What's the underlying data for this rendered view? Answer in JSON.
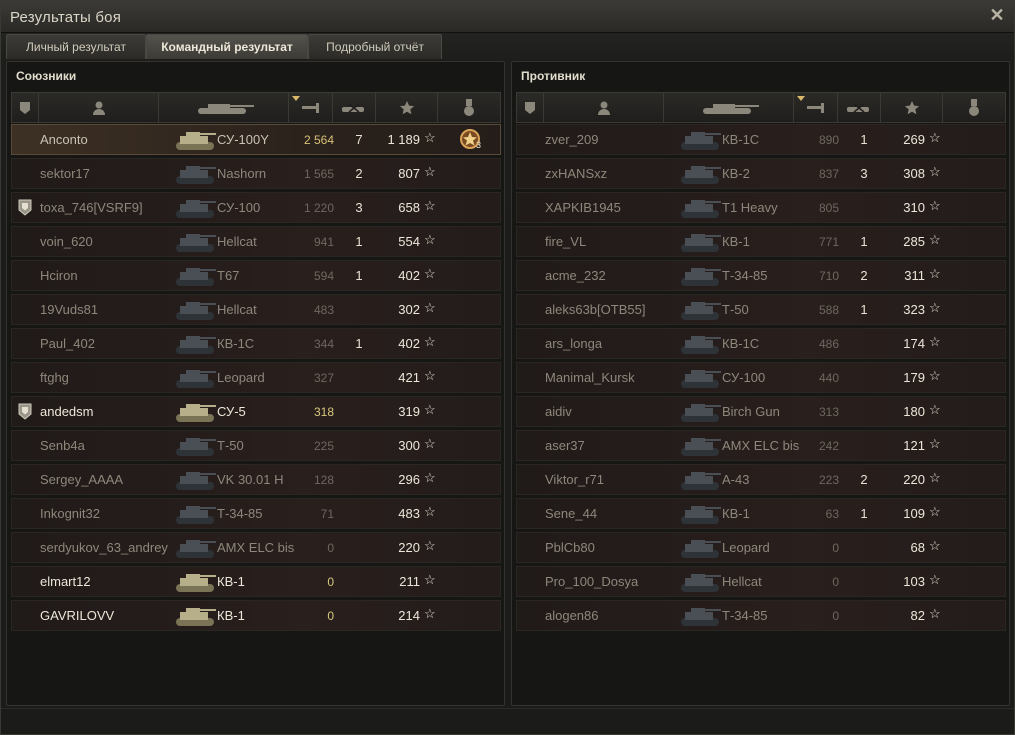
{
  "window": {
    "title": "Результаты боя"
  },
  "tabs": [
    {
      "label": "Личный результат"
    },
    {
      "label": "Командный результат"
    },
    {
      "label": "Подробный отчёт"
    }
  ],
  "allies": {
    "title": "Союзники",
    "rows": [
      {
        "name": "Anconto",
        "tank": "СУ-100Y",
        "damage": "2 564",
        "kills": "7",
        "xp": "1 189",
        "state": "highlight",
        "platoon": false,
        "medal": "3"
      },
      {
        "name": "sektor17",
        "tank": "Nashorn",
        "damage": "1 565",
        "kills": "2",
        "xp": "807",
        "state": "dead",
        "platoon": false
      },
      {
        "name": "toxa_746[VSRF9]",
        "tank": "СУ-100",
        "damage": "1 220",
        "kills": "3",
        "xp": "658",
        "state": "dead",
        "platoon": true
      },
      {
        "name": "voin_620",
        "tank": "Hellcat",
        "damage": "941",
        "kills": "1",
        "xp": "554",
        "state": "dead",
        "platoon": false
      },
      {
        "name": "Hciron",
        "tank": "T67",
        "damage": "594",
        "kills": "1",
        "xp": "402",
        "state": "dead",
        "platoon": false
      },
      {
        "name": "19Vuds81",
        "tank": "Hellcat",
        "damage": "483",
        "kills": "",
        "xp": "302",
        "state": "dead",
        "platoon": false
      },
      {
        "name": "Paul_402",
        "tank": "КВ-1С",
        "damage": "344",
        "kills": "1",
        "xp": "402",
        "state": "dead",
        "platoon": false
      },
      {
        "name": "ftghg",
        "tank": "Leopard",
        "damage": "327",
        "kills": "",
        "xp": "421",
        "state": "dead",
        "platoon": false
      },
      {
        "name": "andedsm",
        "tank": "СУ-5",
        "damage": "318",
        "kills": "",
        "xp": "319",
        "state": "alive",
        "platoon": true
      },
      {
        "name": "Senb4a",
        "tank": "Т-50",
        "damage": "225",
        "kills": "",
        "xp": "300",
        "state": "dead",
        "platoon": false
      },
      {
        "name": "Sergey_AAAA",
        "tank": "VK 30.01 H",
        "damage": "128",
        "kills": "",
        "xp": "296",
        "state": "dead",
        "platoon": false
      },
      {
        "name": "Inkognit32",
        "tank": "Т-34-85",
        "damage": "71",
        "kills": "",
        "xp": "483",
        "state": "dead",
        "platoon": false
      },
      {
        "name": "serdyukov_63_andrey",
        "tank": "AMX ELC bis",
        "damage": "0",
        "kills": "",
        "xp": "220",
        "state": "dead",
        "platoon": false
      },
      {
        "name": "elmart12",
        "tank": "КВ-1",
        "damage": "0",
        "kills": "",
        "xp": "211",
        "state": "alive",
        "platoon": false
      },
      {
        "name": "GAVRILOVV",
        "tank": "КВ-1",
        "damage": "0",
        "kills": "",
        "xp": "214",
        "state": "alive",
        "platoon": false
      }
    ]
  },
  "enemies": {
    "title": "Противник",
    "rows": [
      {
        "name": "zver_209",
        "tank": "КВ-1С",
        "damage": "890",
        "kills": "1",
        "xp": "269",
        "state": "dead",
        "platoon": false
      },
      {
        "name": "zxHANSxz",
        "tank": "КВ-2",
        "damage": "837",
        "kills": "3",
        "xp": "308",
        "state": "dead",
        "platoon": false
      },
      {
        "name": "XAPKIB1945",
        "tank": "T1 Heavy",
        "damage": "805",
        "kills": "",
        "xp": "310",
        "state": "dead",
        "platoon": false
      },
      {
        "name": "fire_VL",
        "tank": "КВ-1",
        "damage": "771",
        "kills": "1",
        "xp": "285",
        "state": "dead",
        "platoon": false
      },
      {
        "name": "acme_232",
        "tank": "Т-34-85",
        "damage": "710",
        "kills": "2",
        "xp": "311",
        "state": "dead",
        "platoon": false
      },
      {
        "name": "aleks63b[OTB55]",
        "tank": "Т-50",
        "damage": "588",
        "kills": "1",
        "xp": "323",
        "state": "dead",
        "platoon": false
      },
      {
        "name": "ars_longa",
        "tank": "КВ-1С",
        "damage": "486",
        "kills": "",
        "xp": "174",
        "state": "dead",
        "platoon": false
      },
      {
        "name": "Manimal_Kursk",
        "tank": "СУ-100",
        "damage": "440",
        "kills": "",
        "xp": "179",
        "state": "dead",
        "platoon": false
      },
      {
        "name": "aidiv",
        "tank": "Birch Gun",
        "damage": "313",
        "kills": "",
        "xp": "180",
        "state": "dead",
        "platoon": false
      },
      {
        "name": "aser37",
        "tank": "AMX ELC bis",
        "damage": "242",
        "kills": "",
        "xp": "121",
        "state": "dead",
        "platoon": false
      },
      {
        "name": "Viktor_r71",
        "tank": "А-43",
        "damage": "223",
        "kills": "2",
        "xp": "220",
        "state": "dead",
        "platoon": false
      },
      {
        "name": "Sene_44",
        "tank": "КВ-1",
        "damage": "63",
        "kills": "1",
        "xp": "109",
        "state": "dead",
        "platoon": false
      },
      {
        "name": "PblCb80",
        "tank": "Leopard",
        "damage": "0",
        "kills": "",
        "xp": "68",
        "state": "dead",
        "platoon": false
      },
      {
        "name": "Pro_100_Dosya",
        "tank": "Hellcat",
        "damage": "0",
        "kills": "",
        "xp": "103",
        "state": "dead",
        "platoon": false
      },
      {
        "name": "alogen86",
        "tank": "Т-34-85",
        "damage": "0",
        "kills": "",
        "xp": "82",
        "state": "dead",
        "platoon": false
      }
    ]
  },
  "icons": {
    "header": [
      "platoon-icon",
      "player-icon",
      "tank-icon",
      "damage-icon",
      "kills-icon",
      "xp-icon",
      "medal-icon"
    ],
    "row_xp": "star-icon"
  },
  "colors": {
    "gold_damage": "#d9c078",
    "alive_text": "#ece7d9",
    "dead_text": "#8d877b"
  }
}
